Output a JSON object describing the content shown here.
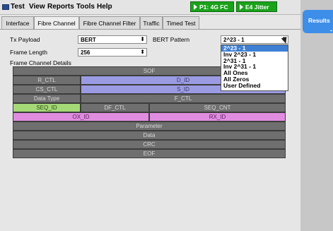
{
  "menubar": {
    "items": [
      "Test",
      "View",
      "Reports",
      "Tools",
      "Help"
    ],
    "badges": [
      "P1: 4G FC",
      "E4 Jitter"
    ]
  },
  "results": {
    "label": "Results",
    "icon": "-"
  },
  "tabs": [
    "Interface",
    "Fibre Channel",
    "Fibre Channel Filter",
    "Traffic",
    "Timed Test"
  ],
  "active_tab": "Fibre Channel",
  "form": {
    "tx_payload": {
      "label": "Tx Payload",
      "value": "BERT"
    },
    "frame_length": {
      "label": "Frame Length",
      "value": "256"
    },
    "bert_pattern": {
      "label": "BERT Pattern",
      "value": "2^23 - 1"
    },
    "frame_details_label": "Frame Channel Details"
  },
  "bert_options": [
    "2^23 - 1",
    "Inv 2^23 - 1",
    "2^31 - 1",
    "Inv 2^31 - 1",
    "All Ones",
    "All Zeros",
    "User Defined"
  ],
  "selected_option": "2^23 - 1",
  "frame": {
    "sof": "SOF",
    "r_ctl": "R_CTL",
    "d_id": "D_ID",
    "cs_ctl": "CS_CTL",
    "s_id": "S_ID",
    "data_type": "Data Type",
    "f_ctl": "F_CTL",
    "seq_id": "SEQ_ID",
    "df_ctl": "DF_CTL",
    "seq_cnt": "SEQ_CNT",
    "ox_id": "OX_ID",
    "rx_id": "RX_ID",
    "parameter": "Parameter",
    "data": "Data",
    "crc": "CRC",
    "eof": "EOF"
  },
  "colors": {
    "badge_green": "#1aa31a",
    "results_blue": "#3d8ee8",
    "field_gray": "#6f6f6f",
    "field_blue": "#9b9be3",
    "field_green": "#a5d977",
    "field_pink": "#e08de0",
    "selection_blue": "#3d7fd4"
  }
}
